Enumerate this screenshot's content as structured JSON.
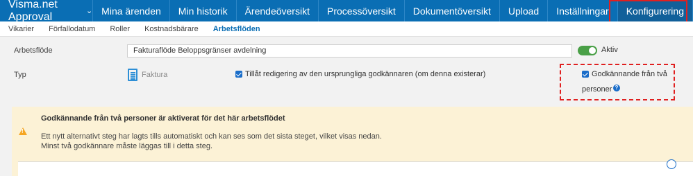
{
  "header": {
    "app_title": "Visma.net Approval",
    "caret_icon": "chevron-down-icon",
    "nav": [
      {
        "label": "Mina ärenden"
      },
      {
        "label": "Min historik"
      },
      {
        "label": "Ärendeöversikt"
      },
      {
        "label": "Processöversikt"
      },
      {
        "label": "Dokumentöversikt"
      },
      {
        "label": "Upload"
      },
      {
        "label": "Inställningar"
      },
      {
        "label": "Konfigurering",
        "active": true
      }
    ]
  },
  "subnav": [
    {
      "label": "Vikarier"
    },
    {
      "label": "Förfallodatum"
    },
    {
      "label": "Roller"
    },
    {
      "label": "Kostnadsbärare"
    },
    {
      "label": "Arbetsflöden",
      "active": true
    }
  ],
  "form": {
    "workflow_label": "Arbetsflöde",
    "workflow_value": "Fakturaflöde Beloppsgränser avdelning",
    "active_label": "Aktiv",
    "active": true,
    "type_label": "Typ",
    "type_value": "Faktura",
    "allow_edit_label": "Tillåt redigering av den ursprungliga godkännaren (om denna existerar)",
    "allow_edit_checked": true,
    "two_person_label_line1": "Godkännande från två",
    "two_person_label_line2": "personer",
    "two_person_checked": true,
    "help_glyph": "?"
  },
  "warning": {
    "title": "Godkännande från två personer är aktiverat för det här arbetsflödet",
    "line1": "Ett nytt alternativt steg har lagts tills automatiskt och kan ses som det sista steget, vilket visas nedan.",
    "line2": "Minst två godkännare måste läggas till i detta steg."
  },
  "colors": {
    "nav_bg": "#0a6eb4",
    "accent": "#1a6dc9",
    "toggle_on": "#4aa047",
    "warning_bg": "#fcf2d6",
    "warning_icon": "#f5a623",
    "highlight": "#e02020"
  }
}
